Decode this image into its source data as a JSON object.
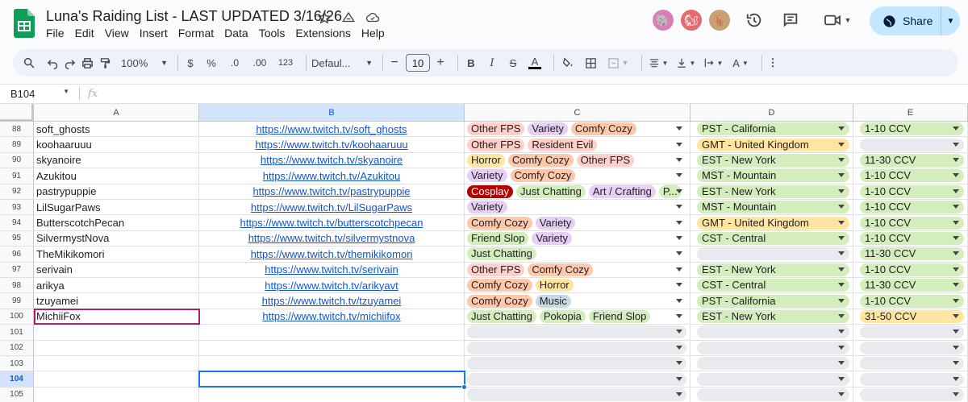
{
  "doc": {
    "title": "Luna's Raiding List - LAST UPDATED 3/16/26"
  },
  "menu": [
    "File",
    "Edit",
    "View",
    "Insert",
    "Format",
    "Data",
    "Tools",
    "Extensions",
    "Help"
  ],
  "share": {
    "label": "Share"
  },
  "toolbar": {
    "zoom": "100%",
    "currency": "$",
    "percent": "%",
    "dec_minus": ".0",
    "dec_plus": ".00",
    "format_123": "123",
    "font": "Defaul...",
    "font_size": "10"
  },
  "namebox": {
    "ref": "B104"
  },
  "formula": {
    "fx": "fx"
  },
  "columns": [
    "A",
    "B",
    "C",
    "D",
    "E"
  ],
  "chip_colors": {
    "Other FPS": "#ffcfc9",
    "Variety": "#e6cff2",
    "Comfy Cozy": "#ffc8aa",
    "Resident Evil": "#ffcfc9",
    "Horror": "#ffe5a0",
    "Cosplay": "#b10202",
    "Just Chatting": "#d4edbc",
    "Art / Crafting": "#e6cff2",
    "Friend Slop": "#d4edbc",
    "Music": "#c6dbe1",
    "Pokopia": "#d4edbc",
    "P...": "#d4edbc"
  },
  "tz_colors": {
    "PST - California": "#d4edbc",
    "GMT - United Kingdom": "#ffe5a0",
    "EST - New York": "#d4edbc",
    "MST - Mountain": "#d4edbc",
    "CST - Central": "#d4edbc"
  },
  "ccv_colors": {
    "1-10 CCV": "#d4edbc",
    "11-30 CCV": "#d4edbc",
    "31-50 CCV": "#ffe5a0"
  },
  "rows": [
    {
      "num": "88",
      "name": "soft_ghosts",
      "url": "https://www.twitch.tv/soft_ghosts",
      "tags": [
        "Other FPS",
        "Variety",
        "Comfy Cozy"
      ],
      "tz": "PST - California",
      "ccv": "1-10 CCV"
    },
    {
      "num": "89",
      "name": "koohaaruuu",
      "url": "https://www.twitch.tv/koohaaruuu",
      "tags": [
        "Other FPS",
        "Resident Evil"
      ],
      "tz": "GMT - United Kingdom",
      "ccv": ""
    },
    {
      "num": "90",
      "name": "skyanoire",
      "url": "https://www.twitch.tv/skyanoire",
      "tags": [
        "Horror",
        "Comfy Cozy",
        "Other FPS"
      ],
      "tz": "EST - New York",
      "ccv": "11-30 CCV"
    },
    {
      "num": "91",
      "name": "Azukitou",
      "url": "https://www.twitch.tv/Azukitou",
      "tags": [
        "Variety",
        "Comfy Cozy"
      ],
      "tz": "MST - Mountain",
      "ccv": "1-10 CCV"
    },
    {
      "num": "92",
      "name": "pastrypuppie",
      "url": "https://www.twitch.tv/pastrypuppie",
      "tags": [
        "Cosplay",
        "Just Chatting",
        "Art / Crafting",
        "P..."
      ],
      "tz": "EST - New York",
      "ccv": "1-10 CCV"
    },
    {
      "num": "93",
      "name": "LilSugarPaws",
      "url": "https://www.twitch.tv/LilSugarPaws",
      "tags": [
        "Variety"
      ],
      "tz": "MST - Mountain",
      "ccv": "1-10 CCV"
    },
    {
      "num": "94",
      "name": "ButterscotchPecan",
      "url": "https://www.twitch.tv/butterscotchpecan",
      "tags": [
        "Comfy Cozy",
        "Variety"
      ],
      "tz": "GMT - United Kingdom",
      "ccv": "1-10 CCV"
    },
    {
      "num": "95",
      "name": "SilvermystNova",
      "url": "https://www.twitch.tv/silvermystnova",
      "tags": [
        "Friend Slop",
        "Variety"
      ],
      "tz": "CST - Central",
      "ccv": "1-10 CCV"
    },
    {
      "num": "96",
      "name": "TheMikikomori",
      "url": "https://www.twitch.tv/themikikomori",
      "tags": [
        "Just Chatting"
      ],
      "tz": "",
      "ccv": "11-30 CCV"
    },
    {
      "num": "97",
      "name": "serivain",
      "url": "https://www.twitch.tv/serivain",
      "tags": [
        "Other FPS",
        "Comfy Cozy"
      ],
      "tz": "EST - New York",
      "ccv": "1-10 CCV"
    },
    {
      "num": "98",
      "name": "arikya",
      "url": "https://www.twitch.tv/arikyavt",
      "tags": [
        "Comfy Cozy",
        "Horror"
      ],
      "tz": "CST - Central",
      "ccv": "11-30 CCV"
    },
    {
      "num": "99",
      "name": "tzuyamei",
      "url": "https://www.twitch.tv/tzuyamei",
      "tags": [
        "Comfy Cozy",
        "Music"
      ],
      "tz": "PST - California",
      "ccv": "1-10 CCV"
    },
    {
      "num": "100",
      "name": "MichiiFox",
      "url": "https://www.twitch.tv/michiifox",
      "tags": [
        "Just Chatting",
        "Pokopia",
        "Friend Slop"
      ],
      "tz": "EST - New York",
      "ccv": "31-50 CCV"
    },
    {
      "num": "101",
      "name": "",
      "url": "",
      "tags": [],
      "tz": "",
      "ccv": ""
    },
    {
      "num": "102",
      "name": "",
      "url": "",
      "tags": [],
      "tz": "",
      "ccv": ""
    },
    {
      "num": "103",
      "name": "",
      "url": "",
      "tags": [],
      "tz": "",
      "ccv": ""
    },
    {
      "num": "104",
      "name": "",
      "url": "",
      "tags": [],
      "tz": "",
      "ccv": ""
    },
    {
      "num": "105",
      "name": "",
      "url": "",
      "tags": [],
      "tz": "",
      "ccv": ""
    }
  ]
}
